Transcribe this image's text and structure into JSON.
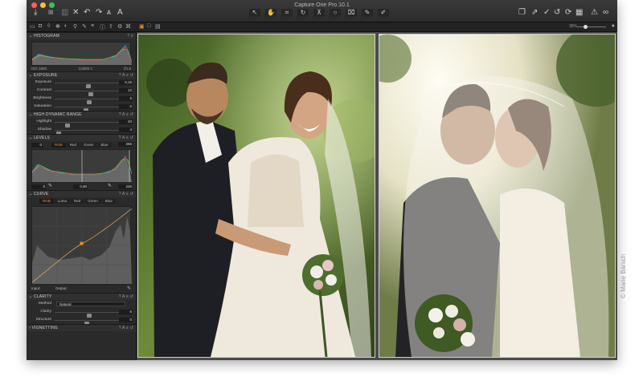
{
  "window": {
    "title": "Capture One Pro 10.1",
    "zoom_label": "36%"
  },
  "toolbar": {
    "left_icons": [
      "import-icon",
      "camera-icon",
      "delete-icon",
      "undo-icon",
      "redo-icon",
      "text-icon"
    ],
    "cursor_tools": [
      "select-tool",
      "pan-tool",
      "crop-tool",
      "rotate-tool",
      "keystone-tool",
      "spot-tool",
      "erase-tool",
      "picker-tool",
      "annotation-tool"
    ],
    "right_icons": [
      "copy-icon",
      "apply-icon",
      "reset-icon",
      "refresh-icon",
      "grid-icon",
      "warning-icon",
      "glasses-icon"
    ]
  },
  "sidebar": {
    "histogram": {
      "title": "HISTOGRAM",
      "iso": "ISO 1600",
      "shutter": "1/4000 s",
      "aperture": "f/1.8"
    },
    "exposure": {
      "title": "EXPOSURE",
      "rows": [
        {
          "label": "Exposure",
          "value": "0,16",
          "level": 0.52
        },
        {
          "label": "Contrast",
          "value": "12",
          "level": 0.56
        },
        {
          "label": "Brightness",
          "value": "6",
          "level": 0.53
        },
        {
          "label": "Saturation",
          "value": "-2",
          "level": 0.49
        }
      ]
    },
    "hdr": {
      "title": "HIGH DYNAMIC RANGE",
      "rows": [
        {
          "label": "Highlight",
          "value": "20",
          "level": 0.2
        },
        {
          "label": "Shadow",
          "value": "4",
          "level": 0.04
        }
      ]
    },
    "levels": {
      "title": "LEVELS",
      "channels": [
        "RGB",
        "Red",
        "Green",
        "Blue"
      ],
      "selected_channel": "RGB",
      "in_low": "0",
      "in_high": "255",
      "out_low": "0",
      "mid": "0,00",
      "out_high": "246"
    },
    "curve": {
      "title": "CURVE",
      "channels": [
        "RGB",
        "Luma",
        "Red",
        "Green",
        "Blue"
      ],
      "selected_channel": "RGB",
      "input_label": "Input:",
      "output_label": "Output:"
    },
    "clarity": {
      "title": "CLARITY",
      "method_label": "Method",
      "method_value": "Natural",
      "rows": [
        {
          "label": "Clarity",
          "value": "6",
          "level": 0.53
        },
        {
          "label": "Structure",
          "value": "0",
          "level": 0.5
        }
      ]
    },
    "vignetting": {
      "title": "VIGNETTING"
    }
  },
  "credit": "© Marie Bärsch",
  "colors": {
    "accent": "#f08c2a",
    "panel": "#2a2a2a",
    "viewer": "#4a4a4a"
  }
}
